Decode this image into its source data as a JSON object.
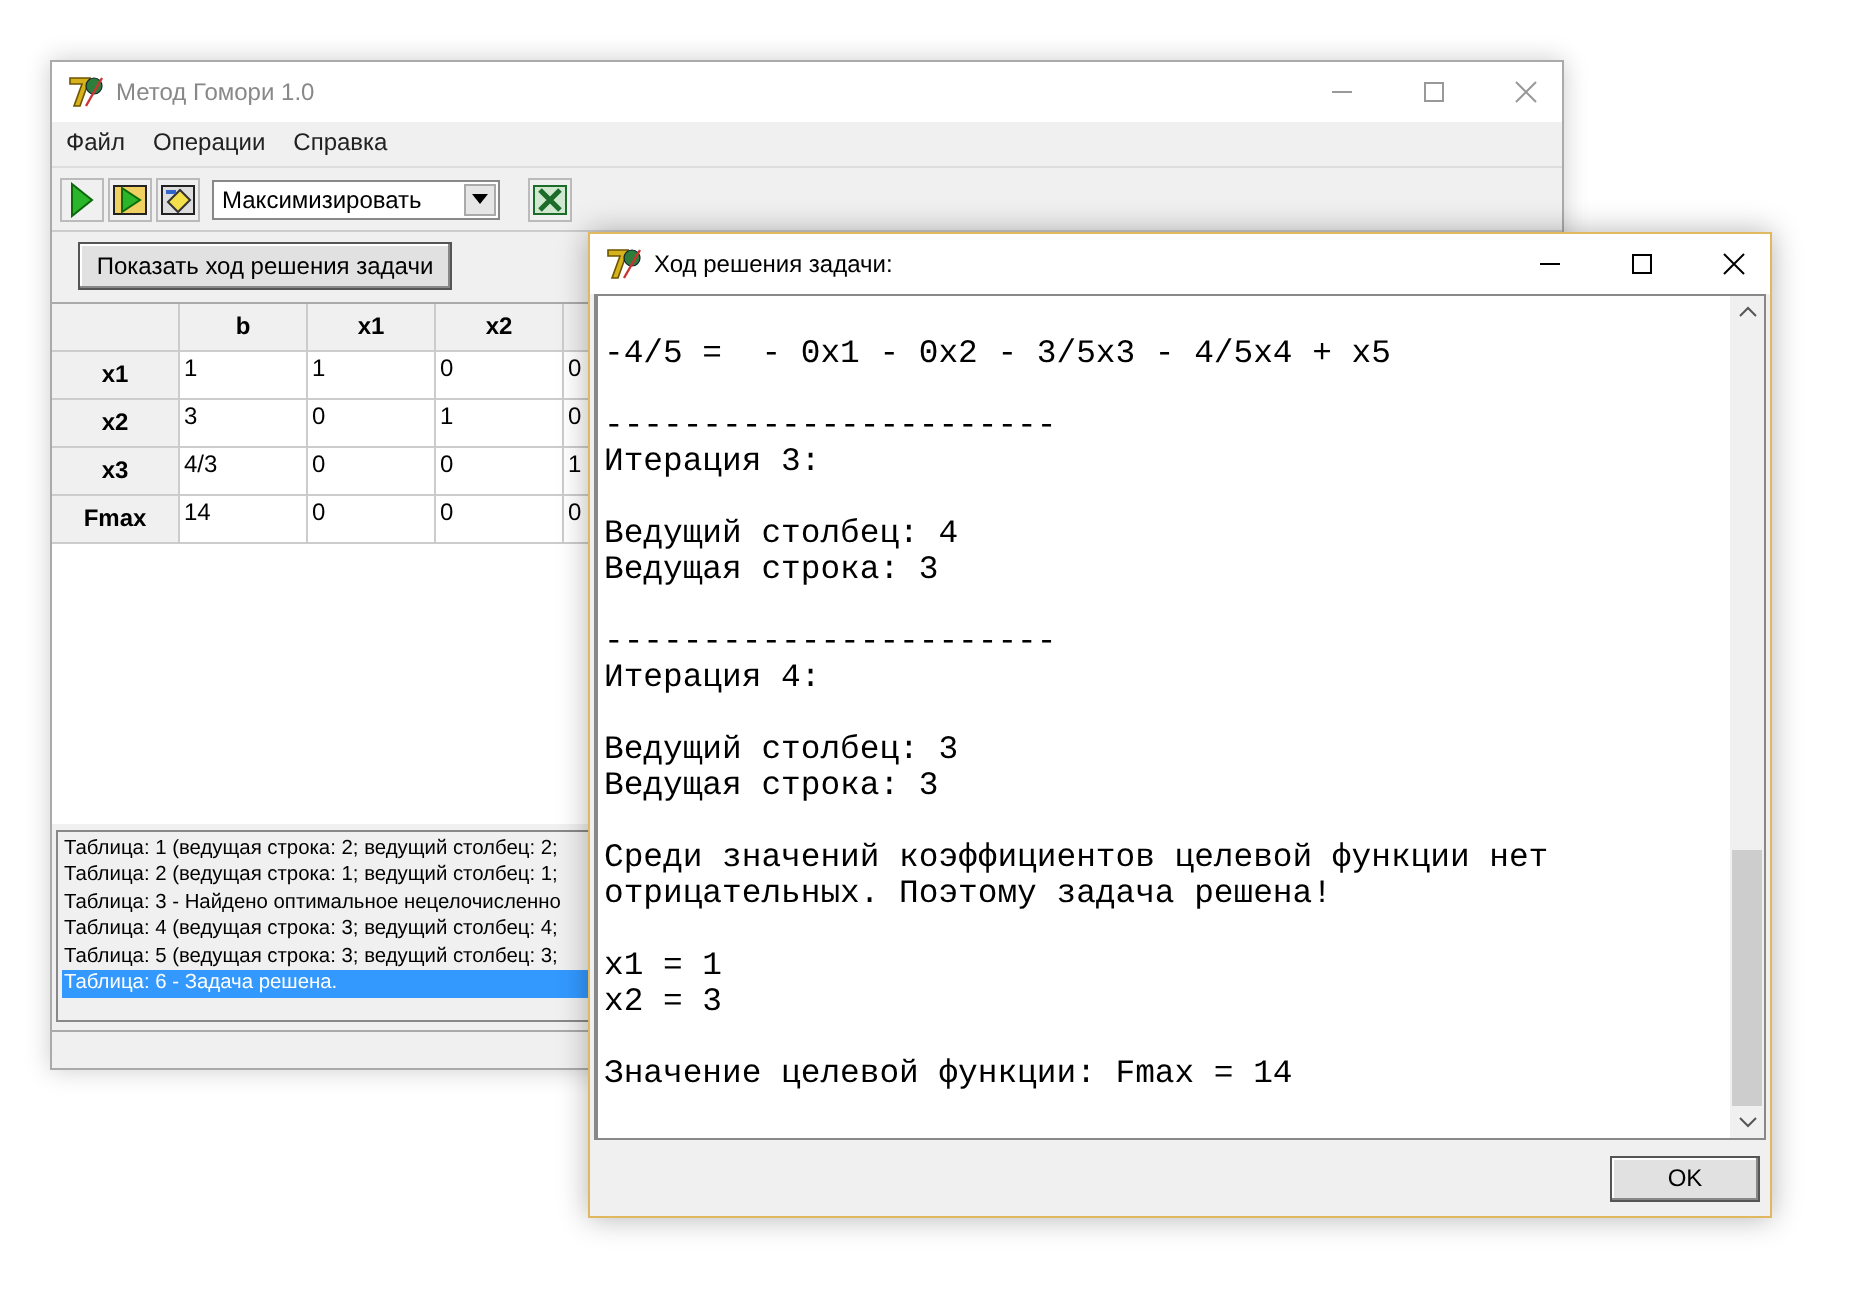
{
  "main_window": {
    "title": "Метод Гомори 1.0",
    "menu": [
      "Файл",
      "Операции",
      "Справка"
    ],
    "mode_select": {
      "value": "Максимизировать"
    },
    "show_solution_button": "Показать ход решения задачи",
    "table": {
      "columns": [
        "b",
        "x1",
        "x2"
      ],
      "rows": [
        {
          "header": "x1",
          "cells": [
            "1",
            "1",
            "0",
            "0"
          ]
        },
        {
          "header": "x2",
          "cells": [
            "3",
            "0",
            "1",
            "0"
          ]
        },
        {
          "header": "x3",
          "cells": [
            "4/3",
            "0",
            "0",
            "1"
          ]
        },
        {
          "header": "Fmax",
          "cells": [
            "14",
            "0",
            "0",
            "0"
          ]
        }
      ]
    },
    "log": [
      {
        "text": "Таблица: 1 (ведущая строка: 2; ведущий столбец: 2;",
        "selected": false
      },
      {
        "text": "Таблица: 2 (ведущая строка: 1; ведущий столбец: 1;",
        "selected": false
      },
      {
        "text": "Таблица: 3 - Найдено оптимальное нецелочисленно",
        "selected": false
      },
      {
        "text": "Таблица: 4 (ведущая строка: 3; ведущий столбец: 4;",
        "selected": false
      },
      {
        "text": "Таблица: 5 (ведущая строка: 3; ведущий столбец: 3;",
        "selected": false
      },
      {
        "text": "Таблица: 6 - Задача решена.",
        "selected": true
      }
    ]
  },
  "dialog": {
    "title": "Ход решения задачи:",
    "blocks": [
      [
        "-4/5 =  - 0x1 - 0x2 - 3/5x3 - 4/5x4 + x5"
      ],
      [
        "-----------------------",
        "Итерация 3:"
      ],
      [
        "Ведущий столбец: 4",
        "Ведущая строка: 3"
      ],
      [
        "-----------------------",
        "Итерация 4:"
      ],
      [
        "Ведущий столбец: 3",
        "Ведущая строка: 3"
      ],
      [
        "Среди значений коэффициентов целевой функции нет",
        "отрицательных. Поэтому задача решена!"
      ],
      [
        "x1 = 1",
        "x2 = 3"
      ],
      [
        "Значение целевой функции: Fmax = 14"
      ]
    ],
    "ok_button": "OK"
  }
}
